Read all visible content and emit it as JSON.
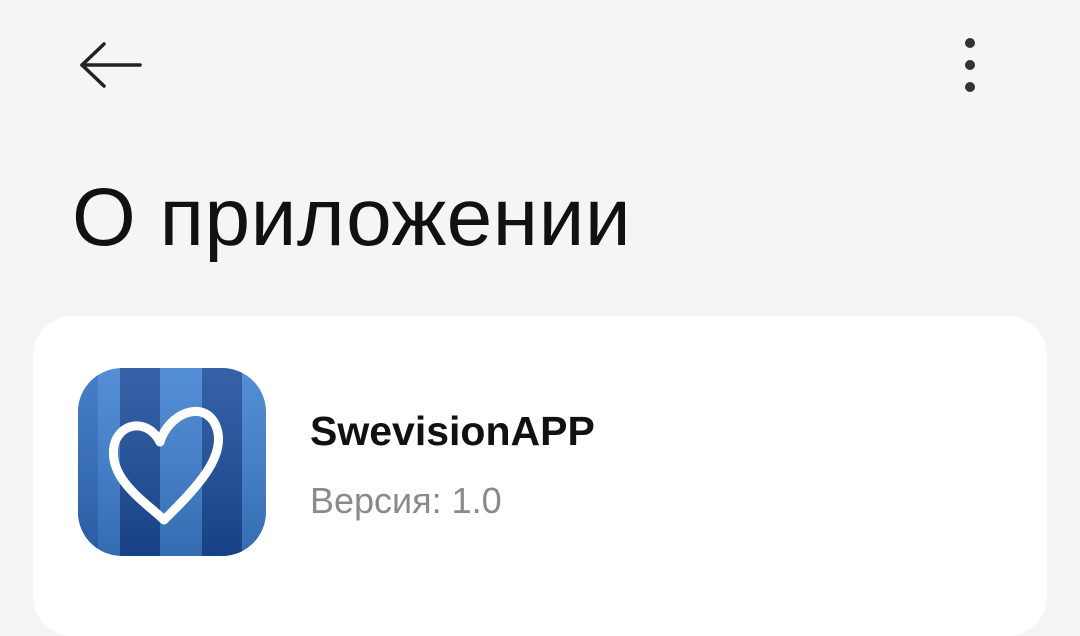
{
  "header": {
    "back_icon": "arrow-left-icon",
    "menu_icon": "more-vertical-icon",
    "title": "О приложении"
  },
  "app_info": {
    "name": "SwevisionAPP",
    "version_label": "Версия: 1.0",
    "icon": "heart-icon",
    "icon_colors": {
      "stripe_light": "#3d7fd0",
      "stripe_dark": "#1b4c9b",
      "heart": "#ffffff"
    }
  },
  "colors": {
    "background": "#f5f5f5",
    "card": "#ffffff",
    "title_text": "#111111",
    "secondary_text": "#8a8a8a"
  }
}
